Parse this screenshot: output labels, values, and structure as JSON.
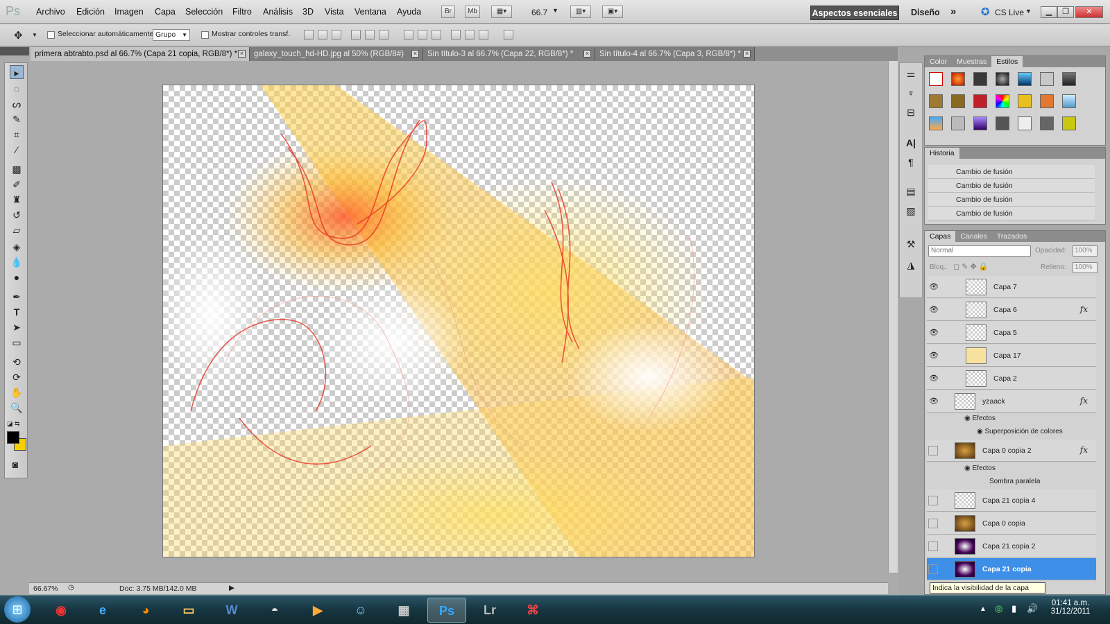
{
  "menubar": {
    "logo": "Ps",
    "items": [
      "Archivo",
      "Edición",
      "Imagen",
      "Capa",
      "Selección",
      "Filtro",
      "Análisis",
      "3D",
      "Vista",
      "Ventana",
      "Ayuda"
    ],
    "btn_br": "Br",
    "btn_mb": "Mb",
    "zoom": "66.7",
    "workspace_active": "Aspectos esenciales",
    "workspace_other": "Diseño",
    "more": "»",
    "cslive": "CS Live"
  },
  "options": {
    "autoselect_label": "Seleccionar automáticamente:",
    "autoselect_value": "Grupo",
    "transform_label": "Mostrar controles transf."
  },
  "tabs": [
    {
      "label": "primera abtrabto.psd al 66.7% (Capa 21 copia, RGB/8*) *"
    },
    {
      "label": "galaxy_touch_hd-HD.jpg al 50% (RGB/8#)"
    },
    {
      "label": "Sin título-3 al 66.7% (Capa 22, RGB/8*) *"
    },
    {
      "label": "Sin título-4 al 66.7% (Capa 3, RGB/8*) *"
    }
  ],
  "status": {
    "zoom": "66.67%",
    "doc": "Doc: 3.75 MB/142.0 MB"
  },
  "panels": {
    "styles_tabs": [
      "Color",
      "Muestras",
      "Estilos"
    ],
    "history_title": "Historia",
    "history": [
      "Cambio de fusión",
      "Cambio de fusión",
      "Cambio de fusión",
      "Cambio de fusión"
    ],
    "layers_tabs": [
      "Capas",
      "Canales",
      "Trazados"
    ],
    "blend_mode": "Normal",
    "opacity_label": "Opacidad:",
    "opacity": "100%",
    "lock_label": "Bloq.:",
    "fill_label": "Relleno:",
    "fill": "100%",
    "layers": [
      {
        "name": "Capa 7",
        "visible": true,
        "fx": ""
      },
      {
        "name": "Capa 6",
        "visible": true,
        "fx": "fx"
      },
      {
        "name": "Capa 5",
        "visible": true,
        "fx": ""
      },
      {
        "name": "Capa 17",
        "visible": true,
        "fx": ""
      },
      {
        "name": "Capa 2",
        "visible": true,
        "fx": ""
      },
      {
        "name": "yzaack",
        "visible": true,
        "fx": "fx"
      },
      {
        "name": "Capa 0 copia 2",
        "visible": false,
        "fx": "fx"
      },
      {
        "name": "Capa 21 copia 4",
        "visible": false,
        "fx": ""
      },
      {
        "name": "Capa 0 copia",
        "visible": false,
        "fx": ""
      },
      {
        "name": "Capa 21 copia 2",
        "visible": false,
        "fx": ""
      },
      {
        "name": "Capa 21 copia",
        "visible": false,
        "fx": ""
      }
    ],
    "effects": {
      "label": "Efectos",
      "color_overlay": "Superposición de colores",
      "drop_shadow": "Sombra paralela"
    },
    "tooltip": "Indica la visibilidad de la capa"
  },
  "clock": {
    "time": "01:41 a.m.",
    "date": "31/12/2011"
  },
  "colors": {
    "accent": "#3d8fe8",
    "fg": "#000000",
    "bg": "#f5d000"
  }
}
